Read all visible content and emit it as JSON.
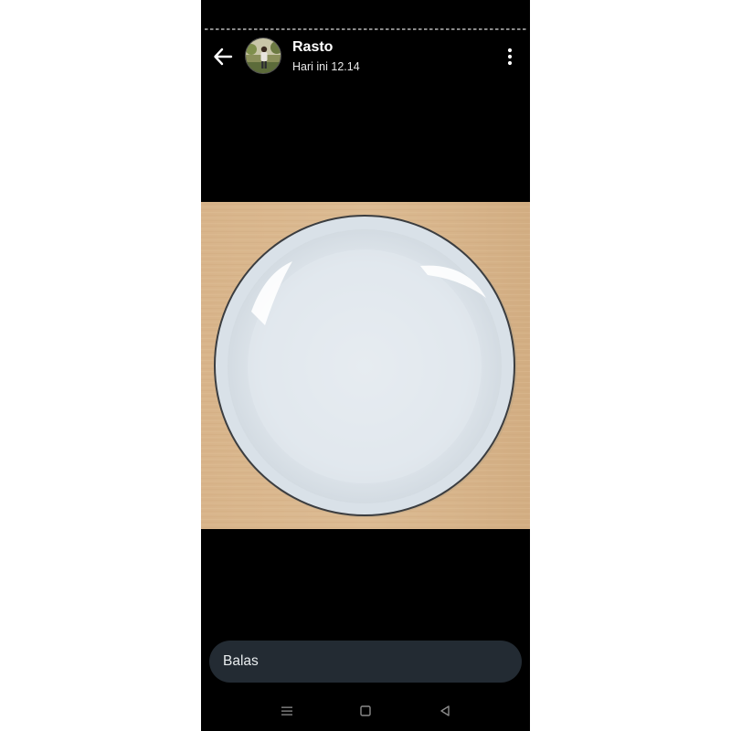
{
  "story": {
    "progress_segments": 1,
    "progress_fraction": 0
  },
  "header": {
    "back_icon": "arrow-left-icon",
    "sender_name": "Rasto",
    "timestamp": "Hari ini 12.14",
    "menu_icon": "more-vertical-icon"
  },
  "media": {
    "subject": "white-plate-on-wood-table"
  },
  "reply": {
    "placeholder": "Balas"
  },
  "navbar": {
    "icons": [
      "menu-icon",
      "home-square-icon",
      "back-triangle-icon"
    ]
  },
  "colors": {
    "background": "#000000",
    "reply_bar": "#232b33",
    "text": "#ffffff"
  }
}
